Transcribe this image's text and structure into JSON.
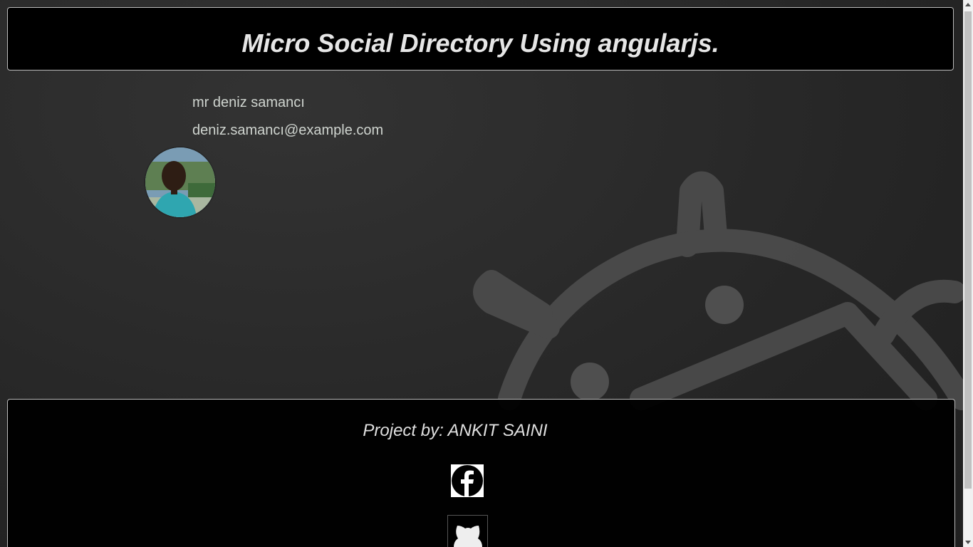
{
  "header": {
    "title": "Micro Social Directory Using angularjs."
  },
  "profile": {
    "name": "mr deniz samancı",
    "email": "deniz.samancı@example.com",
    "avatar_icon": "user-photo"
  },
  "footer": {
    "credit": "Project by: ANKIT SAINI",
    "links": [
      {
        "icon": "facebook-icon"
      },
      {
        "icon": "github-icon"
      }
    ]
  },
  "colors": {
    "background": "#2a2a2a",
    "panel": "#000000",
    "text": "#e6e6e6"
  }
}
